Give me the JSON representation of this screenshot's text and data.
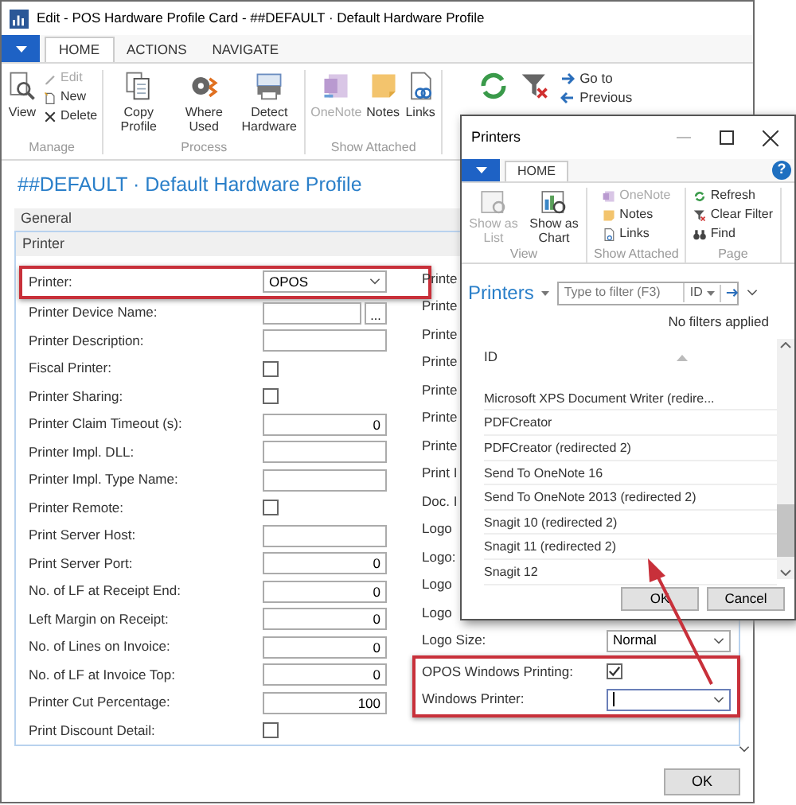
{
  "window": {
    "title": "Edit - POS Hardware Profile Card - ##DEFAULT · Default Hardware Profile"
  },
  "tabs": [
    {
      "label": "HOME",
      "selected": true
    },
    {
      "label": "ACTIONS",
      "selected": false
    },
    {
      "label": "NAVIGATE",
      "selected": false
    }
  ],
  "ribbon": {
    "groups": [
      {
        "label": "Manage",
        "items": [
          {
            "label": "View",
            "kind": "large",
            "disabled": false
          },
          {
            "label": "Edit",
            "kind": "small",
            "disabled": true
          },
          {
            "label": "New",
            "kind": "small",
            "disabled": false
          },
          {
            "label": "Delete",
            "kind": "small",
            "disabled": false
          }
        ]
      },
      {
        "label": "Process",
        "items": [
          {
            "label": "Copy Profile",
            "kind": "large",
            "disabled": false
          },
          {
            "label": "Where Used",
            "kind": "large",
            "disabled": false
          },
          {
            "label": "Detect Hardware",
            "kind": "large",
            "disabled": false
          }
        ]
      },
      {
        "label": "Show Attached",
        "items": [
          {
            "label": "OneNote",
            "kind": "large",
            "disabled": true
          },
          {
            "label": "Notes",
            "kind": "large",
            "disabled": false
          },
          {
            "label": "Links",
            "kind": "large",
            "disabled": false
          }
        ]
      }
    ],
    "more_items": [
      {
        "label": "Go to"
      },
      {
        "label": "Previous"
      }
    ]
  },
  "page_title": "##DEFAULT · Default Hardware Profile",
  "fasttabs": [
    {
      "label": "General"
    }
  ],
  "section": {
    "label": "Printer",
    "left": [
      {
        "highlighted": true,
        "fields": [
          {
            "label": "Printer:",
            "kind": "dropdown",
            "value": "OPOS"
          }
        ]
      },
      {
        "highlighted": false,
        "fields": [
          {
            "label": "Printer Device Name:",
            "kind": "lookup",
            "button": "..."
          },
          {
            "label": "Printer Description:",
            "kind": "text"
          },
          {
            "label": "Fiscal Printer:",
            "kind": "checkbox",
            "checked": false
          },
          {
            "label": "Printer Sharing:",
            "kind": "checkbox",
            "checked": false
          },
          {
            "label": "Printer Claim Timeout (s):",
            "kind": "number",
            "value": "0"
          },
          {
            "label": "Printer Impl. DLL:",
            "kind": "text"
          },
          {
            "label": "Printer Impl. Type Name:",
            "kind": "text"
          },
          {
            "label": "Printer Remote:",
            "kind": "checkbox",
            "checked": false
          },
          {
            "label": "Print Server Host:",
            "kind": "text"
          },
          {
            "label": "Print Server Port:",
            "kind": "number",
            "value": "0"
          },
          {
            "label": "No. of LF at Receipt End:",
            "kind": "number",
            "value": "0"
          },
          {
            "label": "Left Margin on Receipt:",
            "kind": "number",
            "value": "0"
          },
          {
            "label": "No. of Lines on Invoice:",
            "kind": "number",
            "value": "0"
          },
          {
            "label": "No. of LF at Invoice Top:",
            "kind": "number",
            "value": "0"
          },
          {
            "label": "Printer Cut Percentage:",
            "kind": "number",
            "value": "100"
          },
          {
            "label": "Print Discount Detail:",
            "kind": "checkbox",
            "checked": false
          }
        ]
      }
    ],
    "right": [
      {
        "highlighted": false,
        "fields": [
          {
            "label": "Printe",
            "kind": "hidden"
          },
          {
            "label": "Printe",
            "kind": "hidden"
          },
          {
            "label": "Printe",
            "kind": "hidden"
          },
          {
            "label": "Printe",
            "kind": "hidden"
          },
          {
            "label": "Printe",
            "kind": "hidden"
          },
          {
            "label": "Printe",
            "kind": "hidden"
          },
          {
            "label": "Printe",
            "kind": "hidden"
          },
          {
            "label": "Print I",
            "kind": "hidden"
          },
          {
            "label": "Doc. I",
            "kind": "hidden"
          },
          {
            "label": "Logo",
            "kind": "hidden"
          },
          {
            "label": "Logo:",
            "kind": "hidden"
          },
          {
            "label": "Logo",
            "kind": "hidden"
          },
          {
            "label": "Logo",
            "kind": "hidden"
          },
          {
            "label": "Logo Size:",
            "kind": "dropdown",
            "value": "Normal"
          }
        ]
      },
      {
        "highlighted": true,
        "fields": [
          {
            "label": "OPOS Windows Printing:",
            "kind": "checkbox",
            "checked": true
          },
          {
            "label": "Windows Printer:",
            "kind": "dropdown",
            "focused": true
          }
        ]
      }
    ]
  },
  "ok_button": "OK",
  "dialog": {
    "title": "Printers",
    "tabs": [
      {
        "label": "HOME",
        "selected": true
      }
    ],
    "help": "?",
    "ribbon": [
      {
        "label": "View",
        "items": [
          {
            "label": "Show as List",
            "disabled": true
          },
          {
            "label": "Show as Chart",
            "disabled": false
          }
        ]
      },
      {
        "label": "Show Attached",
        "items": [
          {
            "label": "OneNote",
            "disabled": true
          },
          {
            "label": "Notes",
            "disabled": false
          },
          {
            "label": "Links",
            "disabled": false
          }
        ]
      },
      {
        "label": "Page",
        "items": [
          {
            "label": "Refresh",
            "disabled": false
          },
          {
            "label": "Clear Filter",
            "disabled": false
          },
          {
            "label": "Find",
            "disabled": false
          }
        ]
      }
    ],
    "list_title": "Printers",
    "filter": {
      "placeholder": "Type to filter (F3)",
      "field": "ID"
    },
    "filter_status": "No filters applied",
    "columns": [
      "ID"
    ],
    "rows": [
      "Microsoft XPS Document Writer (redire...",
      "PDFCreator",
      "PDFCreator (redirected 2)",
      "Send To OneNote 16",
      "Send To OneNote 2013 (redirected 2)",
      "Snagit 10 (redirected 2)",
      "Snagit 11 (redirected 2)",
      "Snagit 12"
    ],
    "buttons": [
      "OK",
      "Cancel"
    ]
  }
}
